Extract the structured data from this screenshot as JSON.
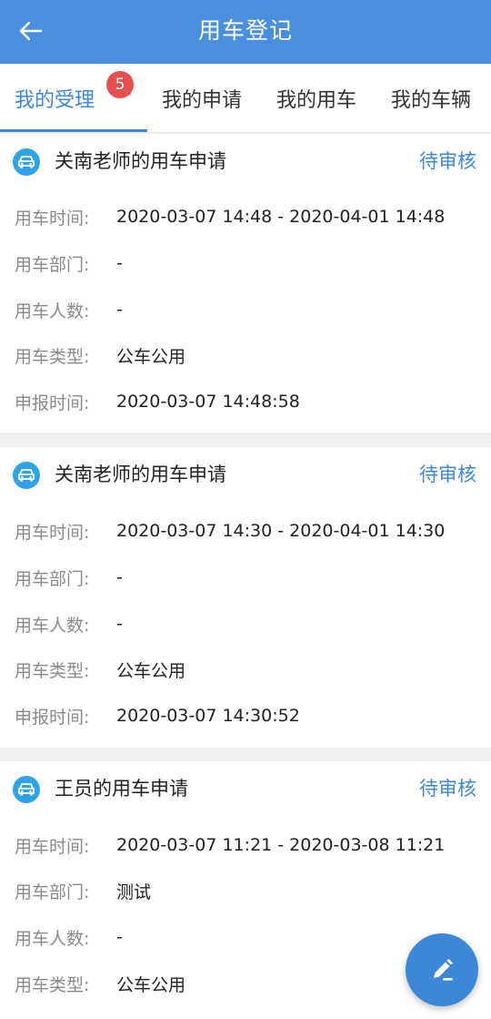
{
  "header": {
    "title": "用车登记"
  },
  "tabs": [
    {
      "label": "我的受理",
      "badge": "5"
    },
    {
      "label": "我的申请"
    },
    {
      "label": "我的用车"
    },
    {
      "label": "我的车辆"
    }
  ],
  "labels": {
    "time": "用车时间:",
    "dept": "用车部门:",
    "count": "用车人数:",
    "type": "用车类型:",
    "submit": "申报时间:"
  },
  "cards": [
    {
      "title": "关南老师的用车申请",
      "status": "待审核",
      "time": "2020-03-07 14:48 - 2020-04-01 14:48",
      "dept": "-",
      "count": "-",
      "type": "公车公用",
      "submit": "2020-03-07 14:48:58"
    },
    {
      "title": "关南老师的用车申请",
      "status": "待审核",
      "time": "2020-03-07 14:30 - 2020-04-01 14:30",
      "dept": "-",
      "count": "-",
      "type": "公车公用",
      "submit": "2020-03-07 14:30:52"
    },
    {
      "title": "王员的用车申请",
      "status": "待审核",
      "time": "2020-03-07 11:21 - 2020-03-08 11:21",
      "dept": "测试",
      "count": "-",
      "type": "公车公用"
    }
  ],
  "colors": {
    "header": "#4a8fdf",
    "accent": "#3c87d8",
    "badge": "#e64f4f",
    "car_icon": "#2fa3e8"
  },
  "icons": {
    "back": "arrow-left-icon",
    "car": "car-icon",
    "fab": "pen-edit-icon"
  }
}
